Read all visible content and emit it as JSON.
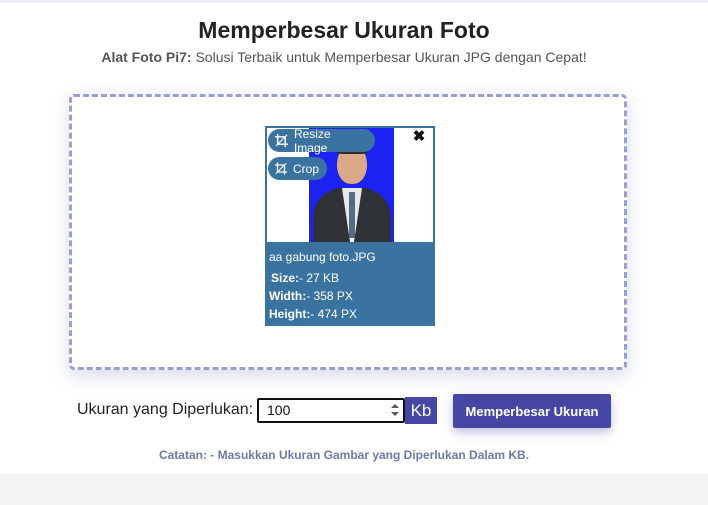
{
  "header": {
    "title": "Memperbesar Ukuran Foto",
    "subtitle_strong": "Alat Foto Pi7:",
    "subtitle_rest": " Solusi Terbaik untuk Memperbesar Ukuran JPG dengan Cepat!"
  },
  "file_card": {
    "resize_label": "Resize Image",
    "crop_label": "Crop",
    "close_glyph": "✖",
    "file_name": "aa gabung foto.JPG",
    "size_label": "Size:",
    "size_value": "- 27 KB",
    "width_label": "Width:",
    "width_value": "- 358 PX",
    "height_label": "Height:",
    "height_value": "- 474 PX"
  },
  "form": {
    "required_label": "Ukuran yang Diperlukan:",
    "size_value": "100",
    "unit": "Kb",
    "submit_label": "Memperbesar Ukuran"
  },
  "note": "Catatan: - Masukkan Ukuran Gambar yang Diperlukan Dalam KB.",
  "colors": {
    "accent": "#4646a4",
    "card": "#3a739f",
    "dashed_border": "#9a9fd0"
  },
  "icons": {
    "resize": "crop-icon",
    "crop": "crop-icon",
    "close": "close-icon"
  }
}
